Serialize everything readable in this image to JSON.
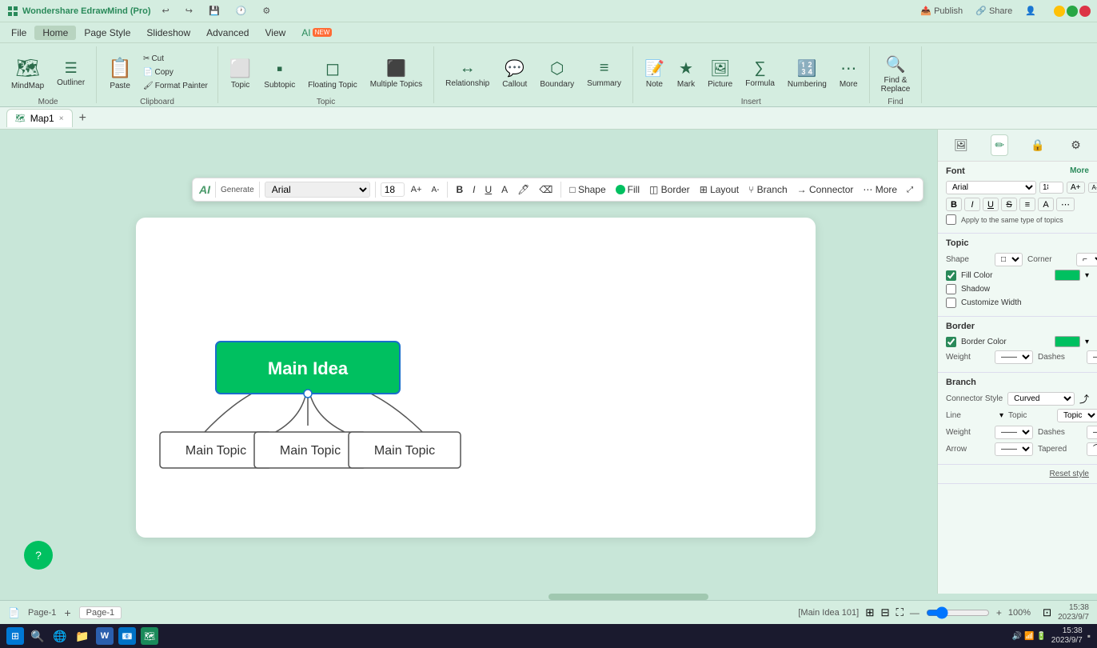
{
  "app": {
    "title": "Wondershare EdrawMind (Pro)",
    "version": "Pro"
  },
  "titlebar": {
    "logo": "Wondershare EdrawMind (Pro)",
    "undo": "↩",
    "redo": "↪",
    "actions": [
      "Publish",
      "Share"
    ],
    "winButtons": [
      "−",
      "□",
      "×"
    ]
  },
  "menubar": {
    "items": [
      "File",
      "Home",
      "Page Style",
      "Slideshow",
      "Advanced",
      "View",
      "AI"
    ]
  },
  "ribbon": {
    "groups": [
      {
        "label": "Mode",
        "items": [
          {
            "id": "mindmap",
            "icon": "🗺",
            "label": "MindMap"
          },
          {
            "id": "outliner",
            "icon": "☰",
            "label": "Outliner"
          }
        ]
      },
      {
        "label": "Clipboard",
        "items": [
          {
            "id": "paste",
            "icon": "📋",
            "label": "Paste"
          },
          {
            "id": "cut",
            "icon": "✂",
            "label": "Cut"
          },
          {
            "id": "copy",
            "icon": "📄",
            "label": "Copy"
          }
        ]
      },
      {
        "label": "Topic",
        "items": [
          {
            "id": "format-painter",
            "icon": "🖌",
            "label": "Format Painter"
          },
          {
            "id": "topic",
            "icon": "⬜",
            "label": "Topic"
          },
          {
            "id": "subtopic",
            "icon": "▪",
            "label": "Subtopic"
          },
          {
            "id": "floating-topic",
            "icon": "◻",
            "label": "Floating Topic"
          },
          {
            "id": "multiple-topics",
            "icon": "⬛",
            "label": "Multiple Topics"
          }
        ]
      },
      {
        "label": "",
        "items": [
          {
            "id": "relationship",
            "icon": "↔",
            "label": "Relationship"
          },
          {
            "id": "callout",
            "icon": "💬",
            "label": "Callout"
          },
          {
            "id": "boundary",
            "icon": "⬡",
            "label": "Boundary"
          },
          {
            "id": "summary",
            "icon": "≡",
            "label": "Summary"
          }
        ]
      },
      {
        "label": "Insert",
        "items": [
          {
            "id": "note",
            "icon": "📝",
            "label": "Note"
          },
          {
            "id": "mark",
            "icon": "★",
            "label": "Mark"
          },
          {
            "id": "picture",
            "icon": "🖼",
            "label": "Picture"
          },
          {
            "id": "formula",
            "icon": "∑",
            "label": "Formula"
          },
          {
            "id": "numbering",
            "icon": "≡",
            "label": "Numbering"
          },
          {
            "id": "more",
            "icon": "⋯",
            "label": "More"
          }
        ]
      },
      {
        "label": "Find",
        "items": [
          {
            "id": "find-replace",
            "icon": "🔍",
            "label": "Find & Replace"
          }
        ]
      }
    ]
  },
  "tabs": {
    "items": [
      {
        "id": "map1",
        "label": "Map1",
        "active": true
      }
    ],
    "add_label": "+"
  },
  "floatingToolbar": {
    "ai_label": "AI",
    "generate_label": "Generate",
    "font_value": "Arial",
    "font_size": "18",
    "increase_font": "A+",
    "decrease_font": "A-",
    "bold": "B",
    "italic": "I",
    "underline": "U",
    "font_color": "A",
    "shape_items": [
      "Shape",
      "Fill",
      "Border",
      "Layout",
      "Branch",
      "Connector",
      "More"
    ]
  },
  "mindmap": {
    "main_idea": "Main Idea",
    "topics": [
      "Main Topic",
      "Main Topic",
      "Main Topic"
    ]
  },
  "rightPanel": {
    "icons": [
      "🖼",
      "✏",
      "🔒",
      "⚙"
    ],
    "font": {
      "title": "Font",
      "more": "More",
      "family": "Arial",
      "size": "18",
      "bold": "B",
      "italic": "I",
      "underline": "U",
      "strikethrough": "S",
      "align": "≡",
      "color": "A",
      "apply_label": "Apply to the same type of topics"
    },
    "topic": {
      "title": "Topic",
      "shape_label": "Shape",
      "shape_value": "□",
      "corner_label": "Corner",
      "corner_value": "⌐",
      "fill_color_label": "Fill Color",
      "fill_color": "#00c060",
      "shadow_label": "Shadow",
      "customize_width_label": "Customize Width"
    },
    "border": {
      "title": "Border",
      "border_color_label": "Border Color",
      "border_color": "#00c060",
      "weight_label": "Weight",
      "dashes_label": "Dashes"
    },
    "branch": {
      "title": "Branch",
      "connector_style_label": "Connector Style",
      "line_label": "Line",
      "topic_label": "Topic",
      "weight_label": "Weight",
      "dashes_label": "Dashes",
      "arrow_label": "Arrow",
      "tapered_label": "Tapered"
    },
    "reset_btn": "Reset style"
  },
  "statusBar": {
    "page_label": "Page-1",
    "add_page": "+",
    "page_name": "Page-1",
    "context": "[Main Idea 101]",
    "icons": [
      "⊞",
      "⊟",
      "⊠"
    ],
    "zoom_controls": "—◻—",
    "zoom_level": "100%",
    "fit_icon": "⛶",
    "datetime": "15:38\n2023/9/7"
  },
  "taskbar": {
    "items": [
      "🔍",
      "⊞",
      "W",
      "☰",
      "🔍",
      "🌐",
      "📁",
      "🎨"
    ]
  }
}
